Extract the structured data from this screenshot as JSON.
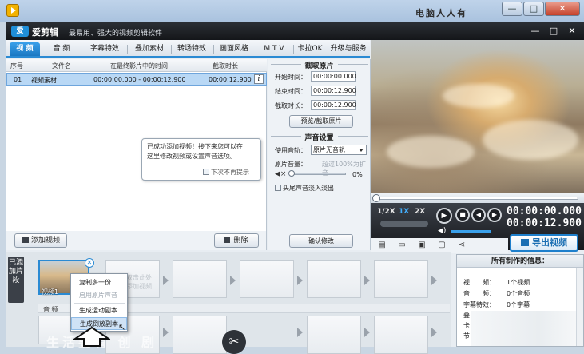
{
  "outer": {
    "watermark": "电脑人人有",
    "min": "—",
    "max": "□",
    "close": "✕"
  },
  "app": {
    "logo_text": "爱",
    "name": "爱剪辑",
    "slogan": "最易用、强大的视频剪辑软件",
    "min": "—",
    "max": "□",
    "close": "✕"
  },
  "tabs": [
    {
      "label": "视 频",
      "active": true
    },
    {
      "label": "音 频"
    },
    {
      "label": "字幕特效"
    },
    {
      "label": "叠加素材"
    },
    {
      "label": "转场特效"
    },
    {
      "label": "画面风格"
    },
    {
      "label": "M T V"
    },
    {
      "label": "卡拉OK"
    },
    {
      "label": "升级与服务"
    }
  ],
  "table": {
    "headers": [
      "序号",
      "文件名",
      "在最终影片中的时间",
      "截取时长"
    ],
    "rows": [
      {
        "index": "01",
        "name": "视频素材",
        "time": "00:00:00.000 - 00:00:12.900",
        "duration": "00:00:12.900",
        "info": "i"
      }
    ]
  },
  "tooltip": {
    "line1": "已成功添加视频！接下来您可以在",
    "line2": "这里修改视频或设置声音选项。",
    "no_remind": "下次不再提示"
  },
  "list_actions": {
    "add_video": "添加视频",
    "delete": "删除"
  },
  "cut": {
    "title": "截取原片",
    "start_label": "开始时间：",
    "start_value": "00:00:00.000",
    "end_label": "结束时间：",
    "end_value": "00:00:12.900",
    "duration_label": "截取时长：",
    "duration_value": "00:00:12.900",
    "preview_button": "预览/截取原片"
  },
  "sound": {
    "title": "声音设置",
    "track_label": "使用音轨：",
    "track_value": "原片无音轨",
    "volume_label": "原片音量：",
    "volume_hint": "超过100%为扩音",
    "volume_percent": "0%",
    "fade_label": "头尾声音淡入淡出",
    "confirm_button": "确认修改"
  },
  "player": {
    "speeds": [
      "1/2X",
      "1X",
      "2X"
    ],
    "current_time": "00:00:00.000",
    "total_time": "00:00:12.900",
    "export_button": "导出视频"
  },
  "timeline": {
    "side_tag": "已添加片段",
    "clip_label": "视频1",
    "hint": "双击此处\n添加视频",
    "audio_label": "音 频",
    "context_menu": [
      {
        "label": "复制多一份",
        "state": "normal"
      },
      {
        "label": "启用原片声音",
        "state": "disabled"
      },
      {
        "label": "生成运动副本",
        "state": "normal"
      },
      {
        "label": "生成倒放副本",
        "state": "highlight"
      }
    ],
    "watermark": "生活要有 创 剧"
  },
  "info": {
    "title": "所有制作的信息：",
    "rows": [
      {
        "k": "视　　频：",
        "v": "1个视频"
      },
      {
        "k": "音　　频：",
        "v": "0个音频"
      },
      {
        "k": "字幕特效：",
        "v": "0个字幕"
      },
      {
        "k": "叠",
        "v": ""
      },
      {
        "k": "卡",
        "v": ""
      },
      {
        "k": "节",
        "v": ""
      }
    ]
  },
  "colors": {
    "accent": "#2a8ad3",
    "title_bar": "#1b1e22"
  }
}
